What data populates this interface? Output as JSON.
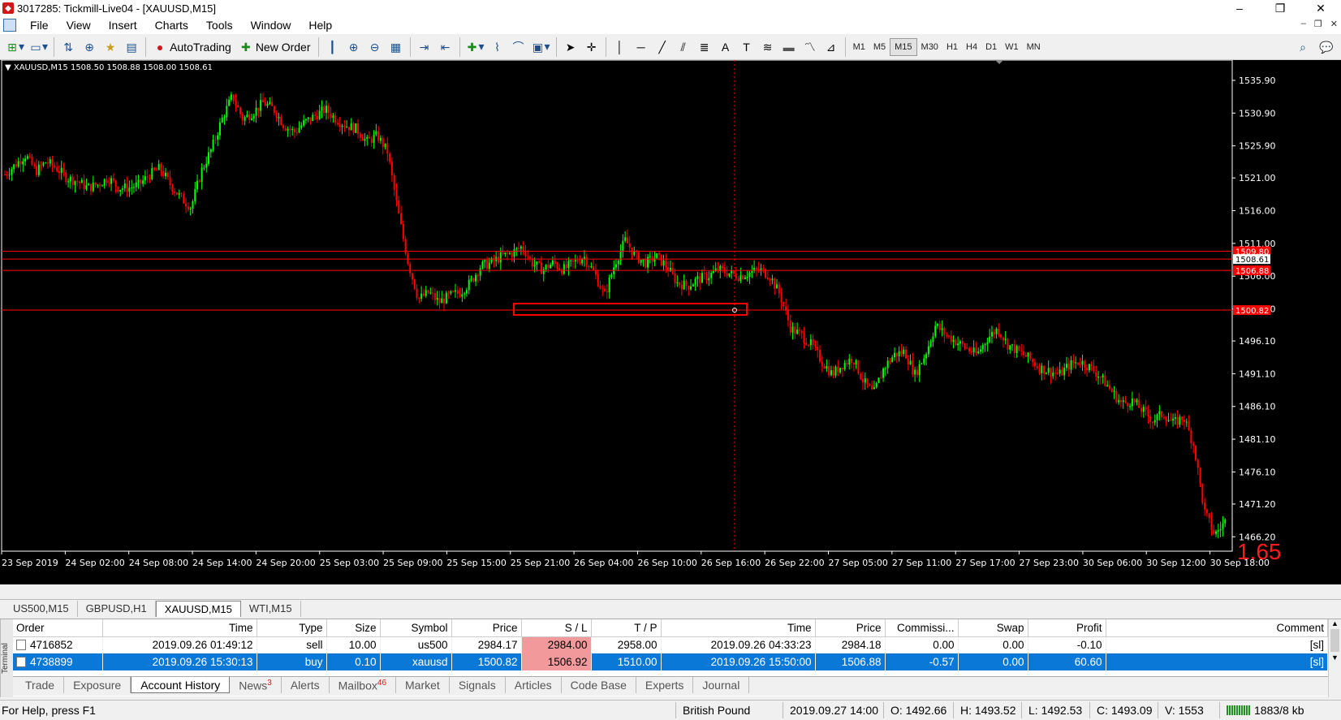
{
  "window": {
    "title": "3017285: Tickmill-Live04 - [XAUUSD,M15]",
    "controls": [
      "–",
      "❐",
      "✕"
    ]
  },
  "menu": {
    "items": [
      "File",
      "View",
      "Insert",
      "Charts",
      "Tools",
      "Window",
      "Help"
    ],
    "mdi_controls": [
      "–",
      "❐",
      "✕"
    ]
  },
  "toolbar": {
    "autotrading_label": "AutoTrading",
    "new_order_label": "New Order",
    "timeframes": [
      "M1",
      "M5",
      "M15",
      "M30",
      "H1",
      "H4",
      "D1",
      "W1",
      "MN"
    ],
    "active_timeframe": "M15"
  },
  "chart": {
    "symbol_info": "▼ XAUUSD,M15  1508.50 1508.88 1508.00 1508.61",
    "big_label": "1.65",
    "colors": {
      "background": "#000000",
      "bull": "#00ff00",
      "bear": "#ff0000",
      "line": "#ff0000",
      "text": "#ffffff"
    }
  },
  "chart_data": {
    "type": "candlestick",
    "y_ticks": [
      "1535.90",
      "1530.90",
      "1525.90",
      "1521.00",
      "1516.00",
      "1511.00",
      "1506.00",
      "1501.00",
      "1496.10",
      "1491.10",
      "1486.10",
      "1481.10",
      "1476.10",
      "1471.20",
      "1466.20"
    ],
    "price_levels": [
      {
        "value": 1509.8,
        "label": "1509.80"
      },
      {
        "value": 1508.61,
        "label": "1508.61"
      },
      {
        "value": 1506.88,
        "label": "1506.88"
      },
      {
        "value": 1500.82,
        "label": "1500.82"
      }
    ],
    "x_ticks": [
      "23 Sep 2019",
      "24 Sep 02:00",
      "24 Sep 08:00",
      "24 Sep 14:00",
      "24 Sep 20:00",
      "25 Sep 03:00",
      "25 Sep 09:00",
      "25 Sep 15:00",
      "25 Sep 21:00",
      "26 Sep 04:00",
      "26 Sep 10:00",
      "26 Sep 16:00",
      "26 Sep 22:00",
      "27 Sep 05:00",
      "27 Sep 11:00",
      "27 Sep 17:00",
      "27 Sep 23:00",
      "30 Sep 06:00",
      "30 Sep 12:00",
      "30 Sep 18:00"
    ],
    "ylim": [
      1464,
      1539
    ],
    "path_closes": [
      1521.5,
      1523.0,
      1524.5,
      1522.0,
      1523.5,
      1522.5,
      1521.0,
      1520.5,
      1519.5,
      1520.0,
      1521.0,
      1519.5,
      1519.5,
      1520.0,
      1521.5,
      1522.5,
      1520.0,
      1518.0,
      1516.5,
      1522.0,
      1525.5,
      1530.0,
      1533.5,
      1530.0,
      1531.0,
      1532.5,
      1531.5,
      1529.0,
      1528.0,
      1529.5,
      1530.5,
      1531.5,
      1530.0,
      1529.0,
      1528.5,
      1526.5,
      1527.5,
      1525.0,
      1516.0,
      1508.0,
      1502.5,
      1503.5,
      1502.0,
      1503.0,
      1503.5,
      1505.0,
      1507.5,
      1508.0,
      1509.0,
      1509.5,
      1510.5,
      1508.0,
      1507.0,
      1508.0,
      1507.0,
      1508.0,
      1509.0,
      1506.5,
      1503.0,
      1508.0,
      1511.5,
      1509.0,
      1508.0,
      1509.0,
      1507.5,
      1505.0,
      1504.5,
      1505.5,
      1506.0,
      1507.0,
      1506.5,
      1506.0,
      1506.5,
      1507.0,
      1506.0,
      1503.0,
      1498.0,
      1497.0,
      1495.5,
      1493.0,
      1491.0,
      1492.5,
      1493.5,
      1490.0,
      1488.0,
      1492.0,
      1494.0,
      1494.5,
      1491.0,
      1494.0,
      1498.5,
      1497.0,
      1496.0,
      1495.0,
      1494.0,
      1496.5,
      1498.0,
      1495.5,
      1494.5,
      1493.5,
      1492.0,
      1491.5,
      1491.0,
      1492.5,
      1493.0,
      1492.0,
      1490.5,
      1488.5,
      1486.5,
      1487.0,
      1485.5,
      1484.0,
      1485.0,
      1483.5,
      1484.5,
      1480.0,
      1470.0,
      1466.5,
      1468.5
    ]
  },
  "chart_tabs": [
    "US500,M15",
    "GBPUSD,H1",
    "XAUUSD,M15",
    "WTI,M15"
  ],
  "active_chart_tab": "XAUUSD,M15",
  "terminal": {
    "side_label": "Terminal",
    "columns": [
      "Order",
      "Time",
      "Type",
      "Size",
      "Symbol",
      "Price",
      "S / L",
      "T / P",
      "Time",
      "Price",
      "Commissi...",
      "Swap",
      "Profit",
      "Comment"
    ],
    "rows": [
      {
        "order": "4716852",
        "time": "2019.09.26 01:49:12",
        "type": "sell",
        "size": "10.00",
        "symbol": "us500",
        "price": "2984.17",
        "sl": "2984.00",
        "tp": "2958.00",
        "close_time": "2019.09.26 04:33:23",
        "close_price": "2984.18",
        "commission": "0.00",
        "swap": "0.00",
        "profit": "-0.10",
        "comment": "[sl]"
      },
      {
        "order": "4738899",
        "time": "2019.09.26 15:30:13",
        "type": "buy",
        "size": "0.10",
        "symbol": "xauusd",
        "price": "1500.82",
        "sl": "1506.92",
        "tp": "1510.00",
        "close_time": "2019.09.26 15:50:00",
        "close_price": "1506.88",
        "commission": "-0.57",
        "swap": "0.00",
        "profit": "60.60",
        "comment": "[sl]"
      }
    ],
    "tabs": [
      {
        "label": "Trade"
      },
      {
        "label": "Exposure"
      },
      {
        "label": "Account History"
      },
      {
        "label": "News",
        "badge": "3"
      },
      {
        "label": "Alerts"
      },
      {
        "label": "Mailbox",
        "badge": "46"
      },
      {
        "label": "Market"
      },
      {
        "label": "Signals"
      },
      {
        "label": "Articles"
      },
      {
        "label": "Code Base"
      },
      {
        "label": "Experts"
      },
      {
        "label": "Journal"
      }
    ],
    "active_tab": "Account History"
  },
  "status": {
    "help": "For Help, press F1",
    "profile": "British Pound",
    "time": "2019.09.27 14:00",
    "open": "O: 1492.66",
    "high": "H: 1493.52",
    "low": "L: 1492.53",
    "close": "C: 1493.09",
    "volume": "V: 1553",
    "traffic": "1883/8 kb"
  }
}
